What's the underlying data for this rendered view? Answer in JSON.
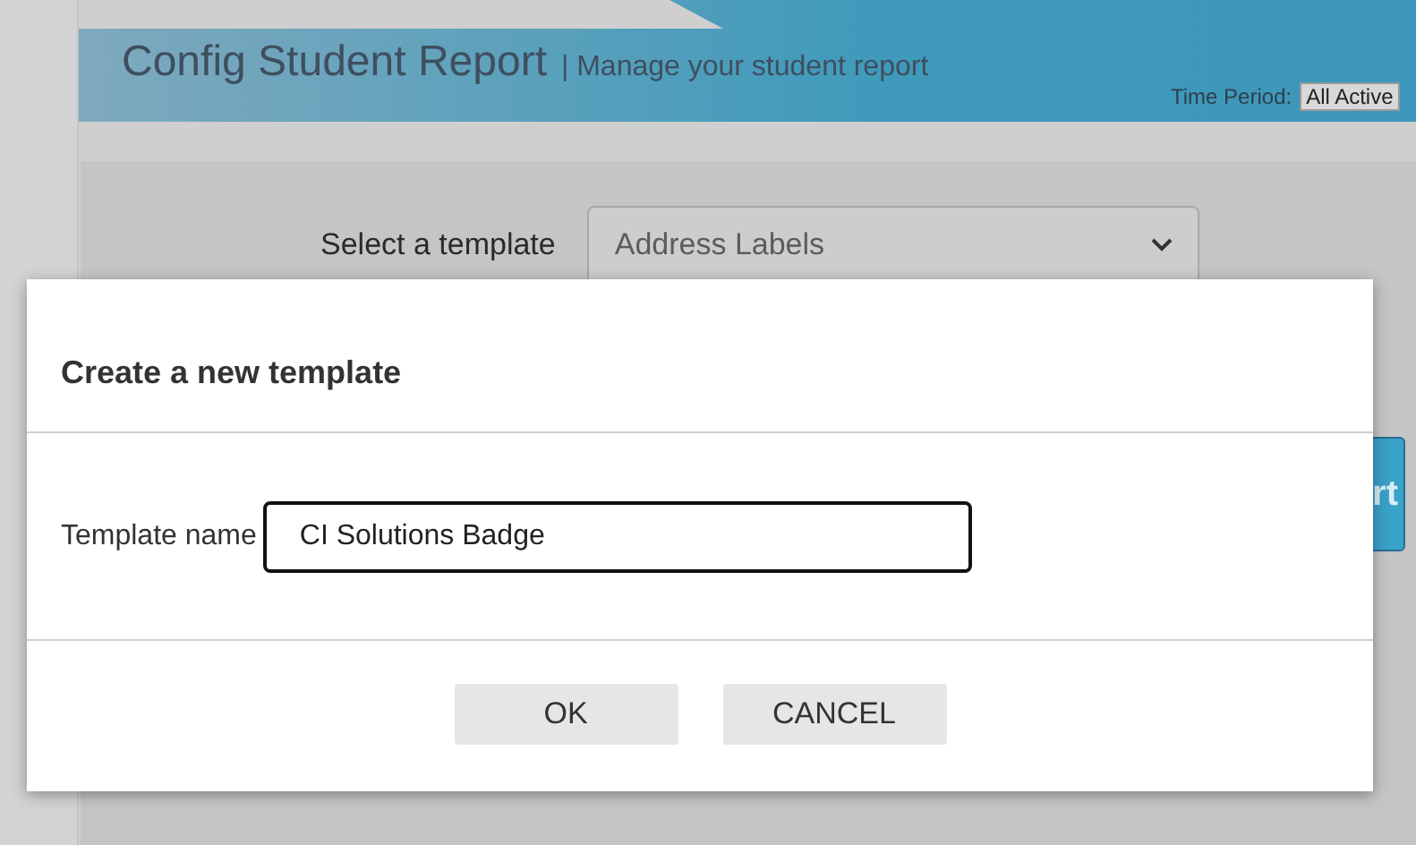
{
  "header": {
    "title": "Config Student Report",
    "subtitle": "| Manage your student report",
    "time_period_label": "Time Period:",
    "time_period_value": "All Active"
  },
  "template_select": {
    "label": "Select a template",
    "value": "Address Labels"
  },
  "background_button": {
    "label": "rt"
  },
  "dialog": {
    "title": "Create a new template",
    "field_label": "Template name",
    "field_value": "CI Solutions Badge",
    "buttons": [
      "OK",
      "CANCEL"
    ]
  }
}
